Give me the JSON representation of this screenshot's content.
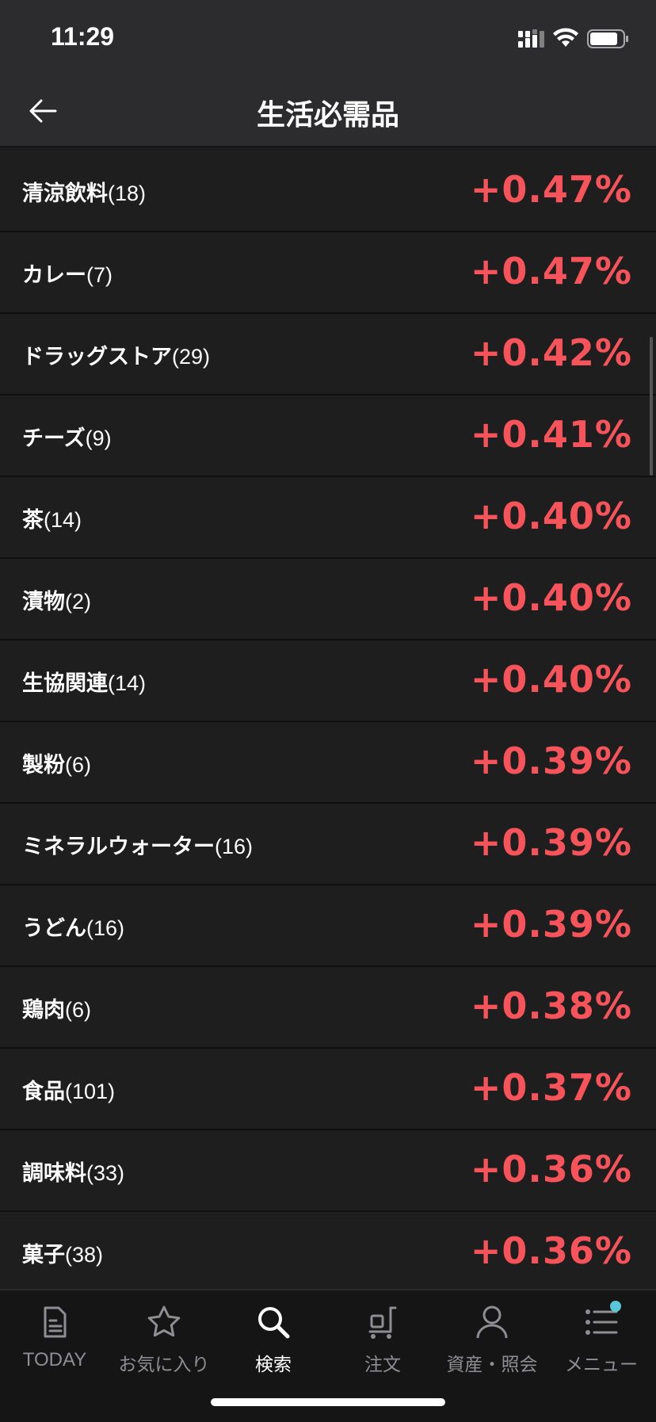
{
  "status": {
    "time": "11:29"
  },
  "header": {
    "title": "生活必需品"
  },
  "rows": [
    {
      "name": "清涼飲料",
      "count": "(18)",
      "value": "+0.47%"
    },
    {
      "name": "カレー",
      "count": "(7)",
      "value": "+0.47%"
    },
    {
      "name": "ドラッグストア",
      "count": "(29)",
      "value": "+0.42%"
    },
    {
      "name": "チーズ",
      "count": "(9)",
      "value": "+0.41%"
    },
    {
      "name": "茶",
      "count": "(14)",
      "value": "+0.40%"
    },
    {
      "name": "漬物",
      "count": "(2)",
      "value": "+0.40%"
    },
    {
      "name": "生協関連",
      "count": "(14)",
      "value": "+0.40%"
    },
    {
      "name": "製粉",
      "count": "(6)",
      "value": "+0.39%"
    },
    {
      "name": "ミネラルウォーター",
      "count": "(16)",
      "value": "+0.39%"
    },
    {
      "name": "うどん",
      "count": "(16)",
      "value": "+0.39%"
    },
    {
      "name": "鶏肉",
      "count": "(6)",
      "value": "+0.38%"
    },
    {
      "name": "食品",
      "count": "(101)",
      "value": "+0.37%"
    },
    {
      "name": "調味料",
      "count": "(33)",
      "value": "+0.36%"
    },
    {
      "name": "菓子",
      "count": "(38)",
      "value": "+0.36%"
    }
  ],
  "tabs": [
    {
      "label": "TODAY",
      "icon": "document-icon"
    },
    {
      "label": "お気に入り",
      "icon": "star-icon"
    },
    {
      "label": "検索",
      "icon": "search-icon"
    },
    {
      "label": "注文",
      "icon": "cart-icon"
    },
    {
      "label": "資産・照会",
      "icon": "person-icon"
    },
    {
      "label": "メニュー",
      "icon": "menu-list-icon"
    }
  ],
  "colors": {
    "positive": "#f6535a",
    "background": "#1c1c1e",
    "accent_dot": "#5ac8d8"
  }
}
